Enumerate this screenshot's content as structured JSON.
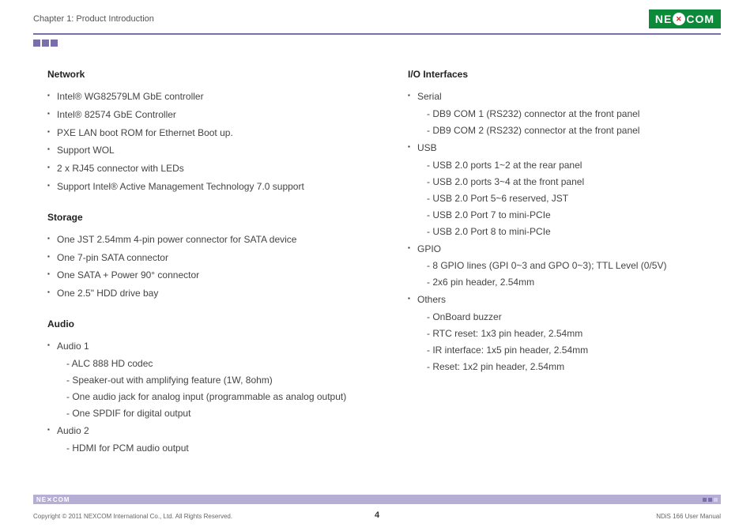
{
  "header": {
    "chapter": "Chapter 1: Product Introduction",
    "logo_pre": "NE",
    "logo_post": "COM"
  },
  "left": {
    "network": {
      "head": "Network",
      "items": [
        "Intel® WG82579LM GbE controller",
        "Intel® 82574 GbE Controller",
        "PXE LAN boot ROM for Ethernet Boot up.",
        "Support WOL",
        "2 x RJ45 connector with LEDs",
        "Support Intel® Active Management Technology 7.0 support"
      ]
    },
    "storage": {
      "head": "Storage",
      "items": [
        "One JST 2.54mm 4-pin power connector for SATA device",
        "One 7-pin SATA connector",
        "One SATA + Power 90° connector",
        "One 2.5\" HDD drive bay"
      ]
    },
    "audio": {
      "head": "Audio",
      "a1_label": "Audio 1",
      "a1_sub": [
        "- ALC 888 HD codec",
        "- Speaker-out with amplifying feature (1W, 8ohm)",
        "- One audio jack for analog input (programmable as analog output)",
        "- One SPDIF for digital output"
      ],
      "a2_label": "Audio 2",
      "a2_sub": [
        "- HDMI for PCM audio output"
      ]
    }
  },
  "right": {
    "io": {
      "head": "I/O Interfaces",
      "serial_label": "Serial",
      "serial_sub": [
        "- DB9 COM 1 (RS232) connector at the front panel",
        "- DB9 COM 2 (RS232) connector at the front panel"
      ],
      "usb_label": "USB",
      "usb_sub": [
        "- USB 2.0 ports 1~2 at the rear panel",
        "- USB 2.0 ports 3~4 at the front panel",
        "- USB 2.0 Port 5~6 reserved, JST",
        "- USB 2.0 Port 7 to mini-PCIe",
        "- USB 2.0 Port 8 to mini-PCIe"
      ],
      "gpio_label": "GPIO",
      "gpio_sub": [
        "- 8 GPIO lines (GPI 0~3 and GPO 0~3); TTL Level (0/5V)",
        "- 2x6 pin header, 2.54mm"
      ],
      "others_label": "Others",
      "others_sub": [
        "- OnBoard buzzer",
        "- RTC reset: 1x3 pin header, 2.54mm",
        "- IR interface: 1x5 pin header, 2.54mm",
        "- Reset: 1x2 pin header, 2.54mm"
      ]
    }
  },
  "footer": {
    "copyright": "Copyright © 2011 NEXCOM International Co., Ltd. All Rights Reserved.",
    "manual": "NDiS 166 User Manual",
    "page": "4",
    "small_logo": "NE✕COM"
  }
}
